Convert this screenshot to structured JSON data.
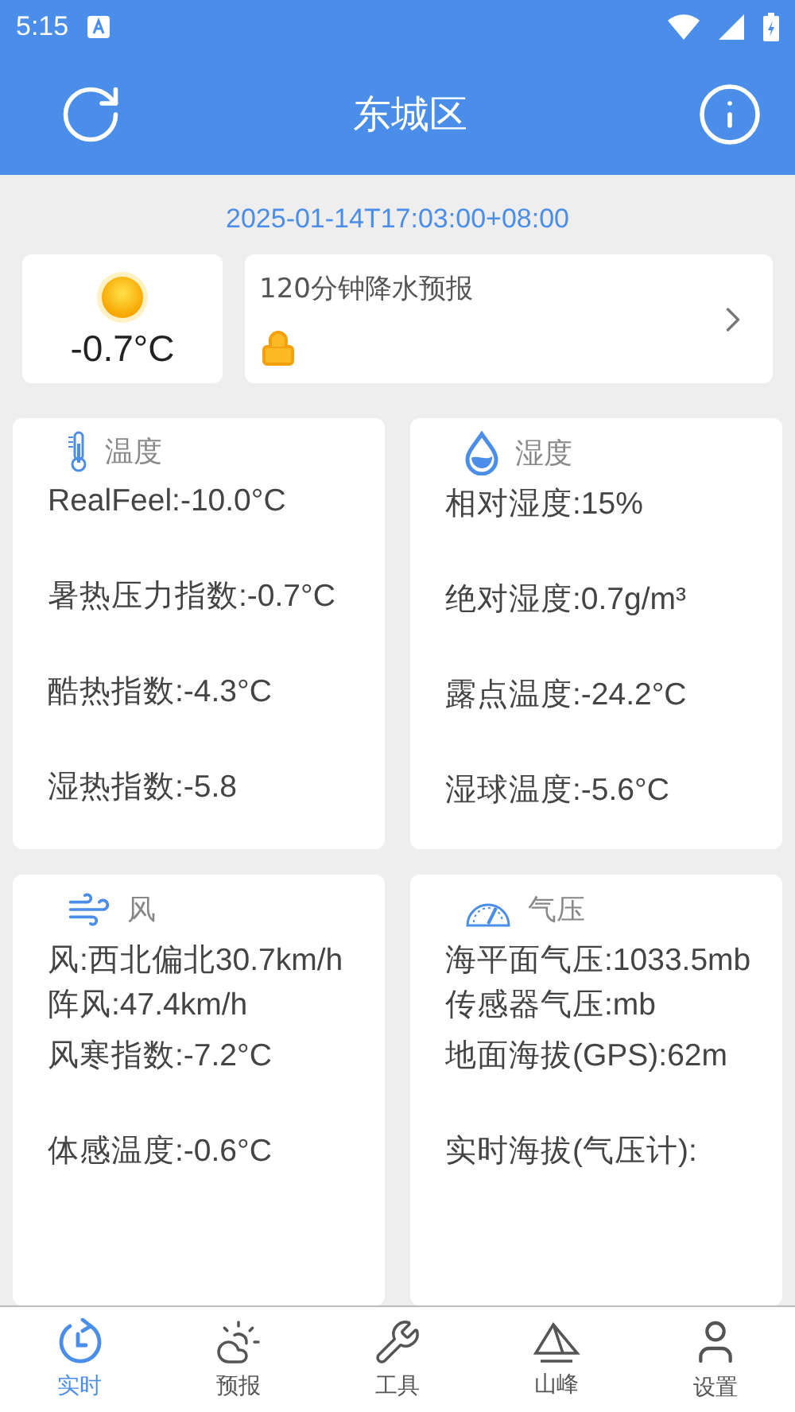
{
  "status_bar": {
    "time": "5:15"
  },
  "header": {
    "title": "东城区"
  },
  "timestamp": "2025-01-14T17:03:00+08:00",
  "current": {
    "temperature": "-0.7°C"
  },
  "forecast_card": {
    "title": "120分钟降水预报",
    "locked": true
  },
  "cards": [
    {
      "kind": "temperature",
      "title": "温度",
      "items": [
        {
          "lines": [
            "RealFeel:-10.0°C"
          ]
        },
        {
          "lines": [
            "暑热压力指数:-0.7°C"
          ]
        },
        {
          "lines": [
            "酷热指数:-4.3°C"
          ]
        },
        {
          "lines": [
            "湿热指数:-5.8"
          ]
        }
      ]
    },
    {
      "kind": "humidity",
      "title": "湿度",
      "items": [
        {
          "lines": [
            "相对湿度:15%"
          ]
        },
        {
          "lines": [
            "绝对湿度:0.7g/m³"
          ]
        },
        {
          "lines": [
            "露点温度:-24.2°C"
          ]
        },
        {
          "lines": [
            "湿球温度:-5.6°C"
          ]
        }
      ]
    },
    {
      "kind": "wind",
      "title": "风",
      "items": [
        {
          "lines": [
            "风:西北偏北30.7km/h",
            "阵风:47.4km/h"
          ]
        },
        {
          "lines": [
            "风寒指数:-7.2°C"
          ]
        },
        {
          "lines": [
            "体感温度:-0.6°C"
          ]
        }
      ]
    },
    {
      "kind": "pressure",
      "title": "气压",
      "items": [
        {
          "lines": [
            "海平面气压:1033.5mb",
            "传感器气压:mb"
          ]
        },
        {
          "lines": [
            "地面海拔(GPS):62m"
          ]
        },
        {
          "lines": [
            "实时海拔(气压计):"
          ]
        }
      ]
    }
  ],
  "nav": [
    {
      "kind": "realtime",
      "label": "实时",
      "selected": true
    },
    {
      "kind": "forecast",
      "label": "预报",
      "selected": false
    },
    {
      "kind": "tools",
      "label": "工具",
      "selected": false
    },
    {
      "kind": "peak",
      "label": "山峰",
      "selected": false
    },
    {
      "kind": "settings",
      "label": "设置",
      "selected": false
    }
  ]
}
